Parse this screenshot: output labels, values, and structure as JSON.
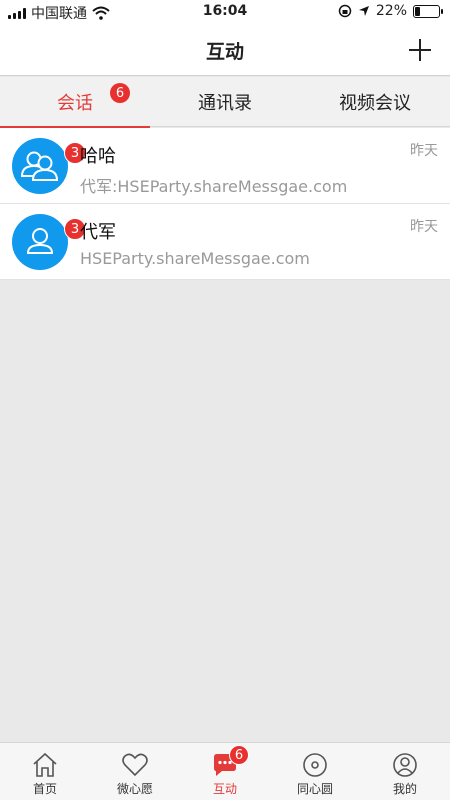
{
  "status_bar": {
    "carrier": "中国联通",
    "time": "16:04",
    "battery": "22%",
    "battery_level": 0.22
  },
  "header": {
    "title": "互动",
    "add_icon": "plus-icon"
  },
  "tabs": [
    {
      "label": "会话",
      "badge": "6",
      "active": true
    },
    {
      "label": "通讯录",
      "active": false
    },
    {
      "label": "视频会议",
      "active": false
    }
  ],
  "conversations": [
    {
      "name": "哈哈",
      "message": "代军:HSEParty.shareMessgae.com",
      "time": "昨天",
      "badge": "3",
      "avatar_icon": "group-avatar-icon"
    },
    {
      "name": "代军",
      "message": "HSEParty.shareMessgae.com",
      "time": "昨天",
      "badge": "3",
      "avatar_icon": "user-avatar-icon"
    }
  ],
  "bottom_nav": [
    {
      "label": "首页",
      "icon": "home-icon"
    },
    {
      "label": "微心愿",
      "icon": "heart-icon"
    },
    {
      "label": "互动",
      "icon": "chat-icon",
      "badge": "6",
      "active": true
    },
    {
      "label": "同心圆",
      "icon": "circle-icon"
    },
    {
      "label": "我的",
      "icon": "profile-icon"
    }
  ],
  "colors": {
    "accent": "#e33a3a",
    "avatar_blue": "#1199ee",
    "badge_red": "#e8312f"
  }
}
